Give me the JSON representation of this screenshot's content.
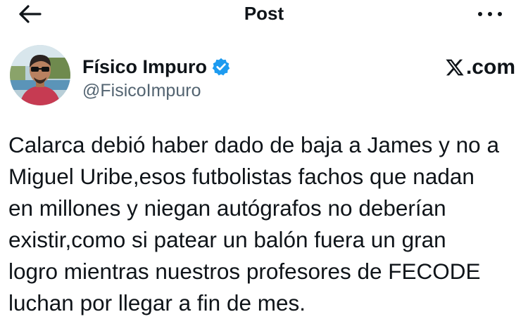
{
  "header": {
    "title": "Post",
    "back_icon": "arrow-left-icon",
    "more_icon": "more-horizontal-icon"
  },
  "author": {
    "display_name": "Físico Impuro",
    "handle": "@FisicoImpuro",
    "verified": true,
    "verified_color": "#1d9bf0",
    "avatar_icon": "user-avatar"
  },
  "source": {
    "label": ".com",
    "logo_icon": "x-logo-icon"
  },
  "tweet": {
    "text": "Calarca debió haber dado de baja a James y no a\nMiguel Uribe,esos futbolistas fachos que nadan\nen millones y niegan autógrafos no deberían\nexistir,como si patear un balón fuera un gran\nlogro mientras nuestros profesores de FECODE\nluchan por llegar a fin de mes."
  }
}
